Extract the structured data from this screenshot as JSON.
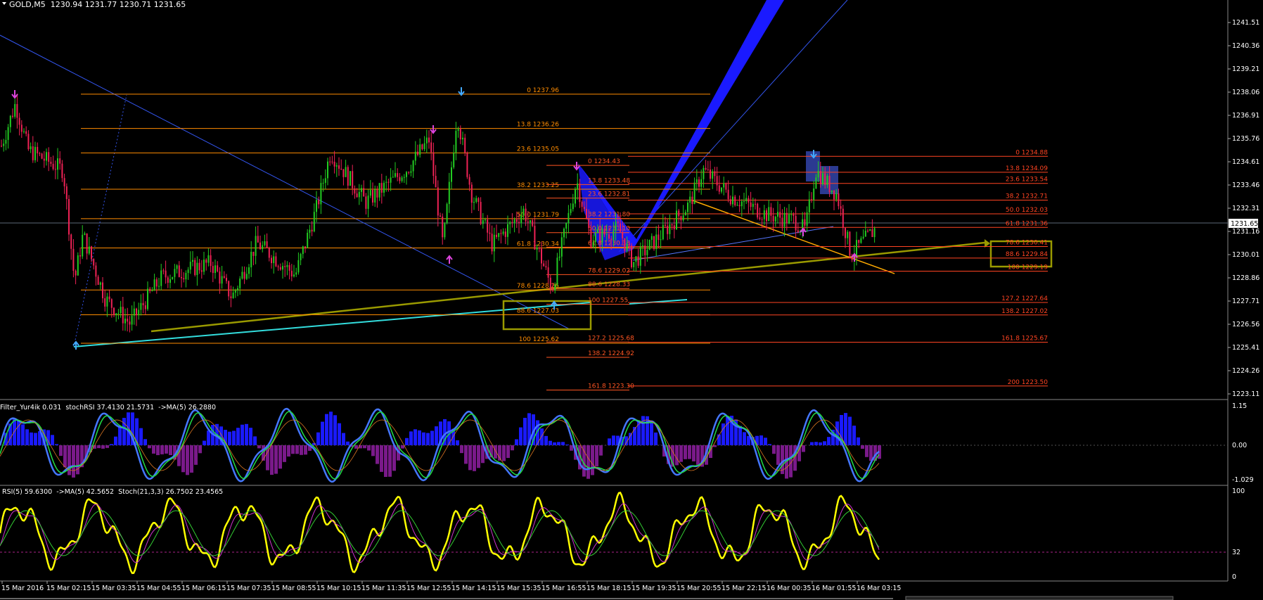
{
  "header": {
    "symbol_line": "GOLD,M5  1230.94 1231.77 1230.71 1231.65",
    "osc1_label": "Filter_Yur4ik 0.031  stochRSI 37.4130 21.5731  ->MA(5) 26.2880",
    "osc2_label": "RSI(5) 59.6300  ->MA(5) 42.5652  Stoch(21,3,3) 26.7502 23.4565"
  },
  "colors": {
    "background": "#000000",
    "bull": "#22cc22",
    "bear": "#ee2255",
    "fib_orange": "#ff8c00",
    "fib_red": "#ff4422",
    "pattern_blue": "#1a1aff",
    "olive": "#9a9a00",
    "cyan": "#33dddd",
    "rsi_yellow": "#ffff00"
  },
  "price_axis": {
    "labels": [
      "1241.51",
      "1240.36",
      "1239.21",
      "1238.06",
      "1236.91",
      "1235.76",
      "1234.61",
      "1233.46",
      "1232.31",
      "1231.16",
      "1230.01",
      "1228.86",
      "1227.71",
      "1226.56",
      "1225.41",
      "1224.26",
      "1223.11"
    ],
    "current_price": "1231.65"
  },
  "osc1_axis": [
    "1.15",
    "0.00",
    "-1.029"
  ],
  "osc2_axis": [
    "100",
    "32",
    "0"
  ],
  "time_axis": [
    "15 Mar 2016",
    "15 Mar 02:15",
    "15 Mar 03:35",
    "15 Mar 04:55",
    "15 Mar 06:15",
    "15 Mar 07:35",
    "15 Mar 08:55",
    "15 Mar 10:15",
    "15 Mar 11:35",
    "15 Mar 12:55",
    "15 Mar 14:15",
    "15 Mar 15:35",
    "15 Mar 16:55",
    "15 Mar 18:15",
    "15 Mar 19:35",
    "15 Mar 20:55",
    "15 Mar 22:15",
    "16 Mar 00:35",
    "16 Mar 01:55",
    "16 Mar 03:15"
  ],
  "fib_set_1": [
    "0 1237.96",
    "13.8 1236.26",
    "23.6 1235.05",
    "38.2 1233.25",
    "50.0 1231.79",
    "61.8 1230.34",
    "78.6 1228.26",
    "88.6 1227.03",
    "100 1225.62"
  ],
  "fib_set_2": [
    "0 1234.43",
    "13.8 1233.48",
    "23.6 1232.81",
    "38.2 1231.80",
    "50.0 1231.10",
    "61.8 1230.38",
    "78.6 1229.02",
    "88.6 1228.33",
    "100 1227.55",
    "127.2 1225.68",
    "138.2 1224.92",
    "161.8 1223.30"
  ],
  "fib_set_3": [
    "0 1234.88",
    "13.8 1234.09",
    "23.6 1233.54",
    "38.2 1232.71",
    "50.0 1232.03",
    "61.8 1231.36",
    "78.6 1230.41",
    "88.6 1229.84",
    "100 1229.19",
    "127.2 1227.64",
    "138.2 1227.02",
    "161.8 1225.67",
    "200 1223.50"
  ]
}
